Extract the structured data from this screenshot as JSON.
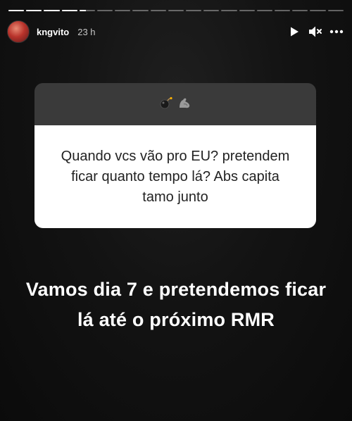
{
  "story": {
    "segments": [
      1,
      1,
      1,
      1,
      0.4,
      0,
      0,
      0,
      0,
      0,
      0,
      0,
      0,
      0,
      0,
      0,
      0,
      0,
      0
    ]
  },
  "header": {
    "username": "kngvito",
    "timestamp": "23 h",
    "icons": [
      "play-icon",
      "mute-icon",
      "more-icon"
    ]
  },
  "question_card": {
    "emoji_icons": [
      "bomb-icon",
      "flexed-biceps-icon"
    ],
    "question": "Quando vcs vão pro EU? pretendem ficar quanto tempo lá? Abs capita tamo junto"
  },
  "answer": {
    "text": "Vamos dia 7 e pretendemos ficar lá até o próximo RMR"
  }
}
